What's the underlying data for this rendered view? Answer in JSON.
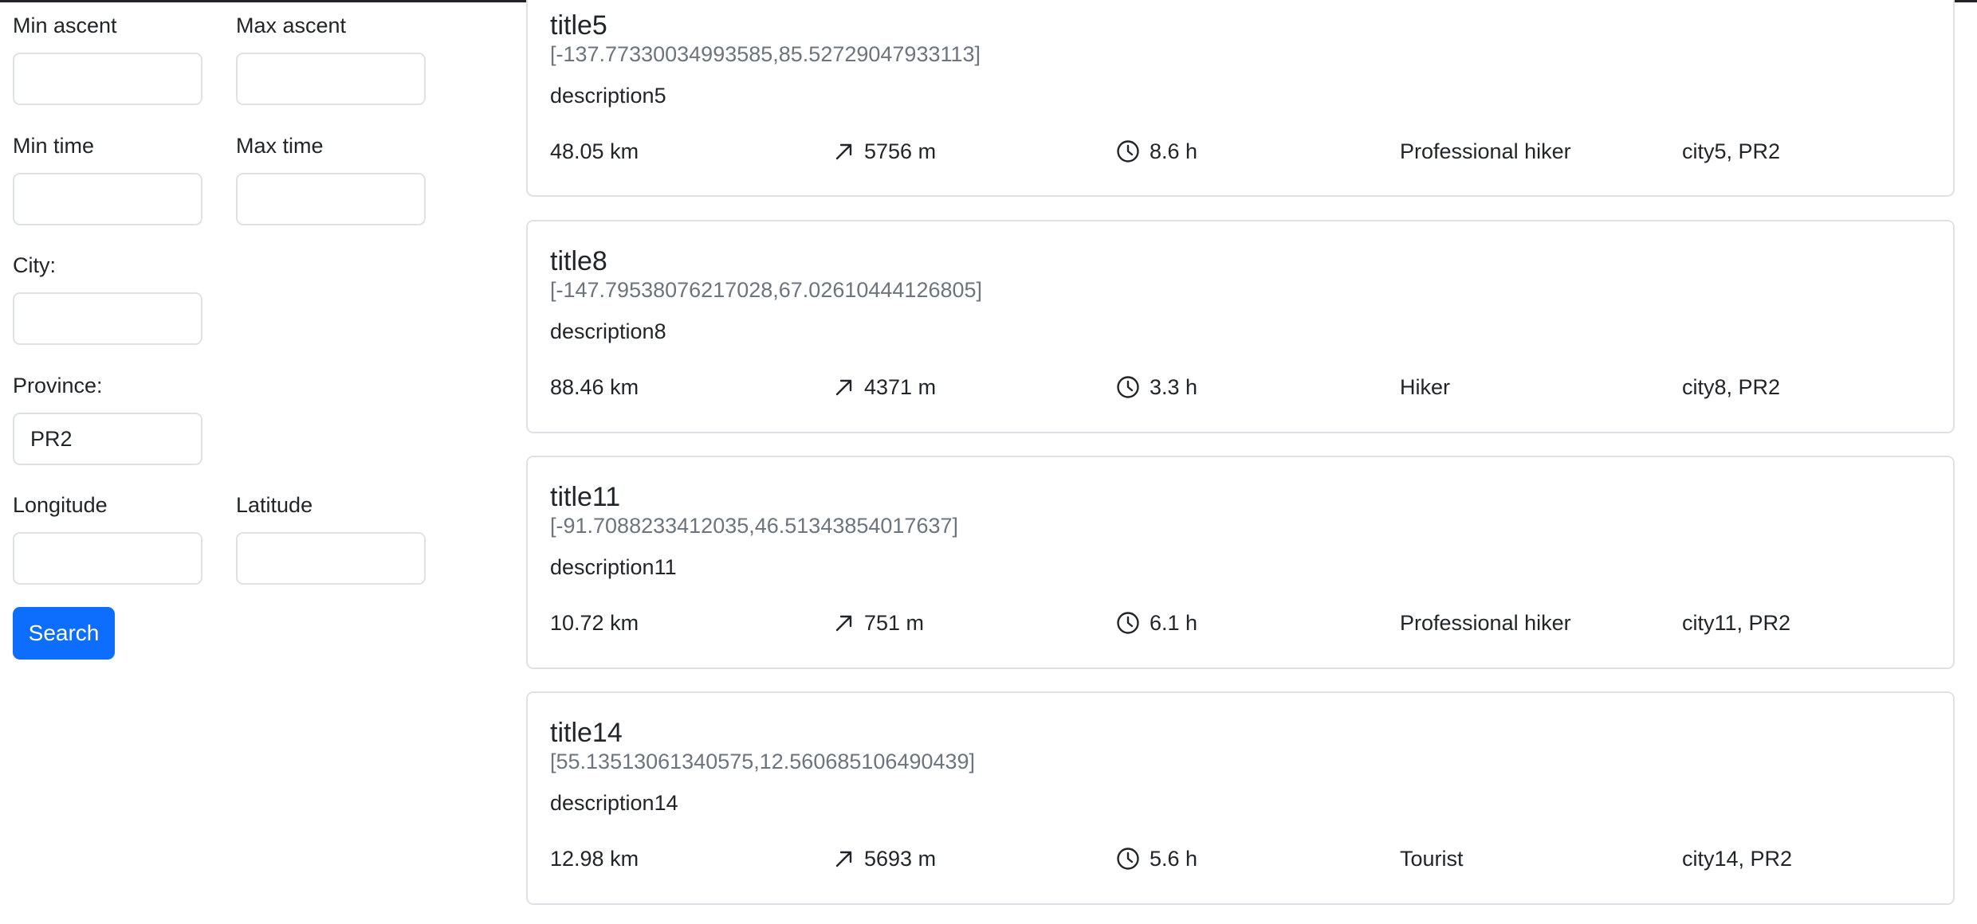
{
  "filters": {
    "min_ascent_label": "Min ascent",
    "max_ascent_label": "Max ascent",
    "min_time_label": "Min time",
    "max_time_label": "Max time",
    "city_label": "City:",
    "province_label": "Province:",
    "province_value": "PR2",
    "longitude_label": "Longitude",
    "latitude_label": "Latitude",
    "search_label": "Search",
    "accent_color": "#0d6efd"
  },
  "hikes": [
    {
      "title": "title5",
      "coords": "[-137.77330034993585,85.52729047933113]",
      "description": "description5",
      "length": "48.05 km",
      "ascent": "5756 m",
      "time": "8.6 h",
      "difficulty": "Professional hiker",
      "location": "city5, PR2"
    },
    {
      "title": "title8",
      "coords": "[-147.79538076217028,67.02610444126805]",
      "description": "description8",
      "length": "88.46 km",
      "ascent": "4371 m",
      "time": "3.3 h",
      "difficulty": "Hiker",
      "location": "city8, PR2"
    },
    {
      "title": "title11",
      "coords": "[-91.7088233412035,46.51343854017637]",
      "description": "description11",
      "length": "10.72 km",
      "ascent": "751 m",
      "time": "6.1 h",
      "difficulty": "Professional hiker",
      "location": "city11, PR2"
    },
    {
      "title": "title14",
      "coords": "[55.13513061340575,12.560685106490439]",
      "description": "description14",
      "length": "12.98 km",
      "ascent": "5693 m",
      "time": "5.6 h",
      "difficulty": "Tourist",
      "location": "city14, PR2"
    }
  ],
  "icons": {
    "ascent": "arrow-up-right-icon",
    "time": "clock-icon"
  }
}
